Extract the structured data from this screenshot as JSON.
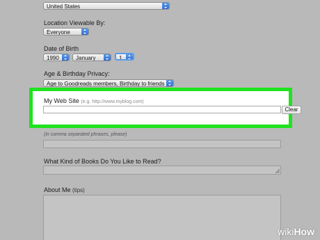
{
  "form": {
    "country": {
      "value": "United States"
    },
    "location_viewable": {
      "label": "Location Viewable By:",
      "value": "Everyone"
    },
    "date_of_birth": {
      "label": "Date of Birth",
      "year": "1990",
      "month": "January",
      "day": "1"
    },
    "age_privacy": {
      "label": "Age & Birthday Privacy:",
      "value": "Age to Goodreads members, Birthday to friends"
    },
    "website": {
      "label": "My Web Site",
      "hint": "(e.g. http://www.myblog.com)",
      "value": "",
      "clear_label": "Clear"
    },
    "interests": {
      "hint": "(in comma separated phrases, please)",
      "value": ""
    },
    "books": {
      "label": "What Kind of Books Do You Like to Read?",
      "value": ""
    },
    "about": {
      "label": "About Me",
      "tips": "(tips)",
      "value": ""
    }
  },
  "watermark": {
    "wiki": "wiki",
    "how": "How"
  },
  "colors": {
    "highlight": "#1ee31e",
    "background": "#b9b9b9",
    "stepper": "#3a7ad8"
  }
}
